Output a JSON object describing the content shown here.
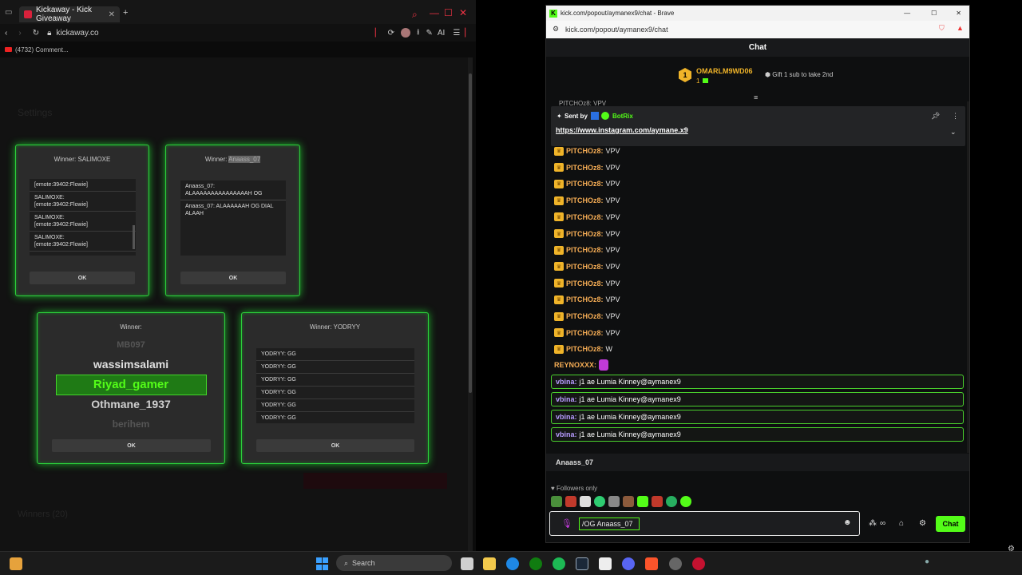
{
  "left_browser": {
    "tab_title": "Kickaway - Kick Giveaway",
    "new_tab": "+",
    "url": "kickaway.co",
    "bookmark": "(4732) Comment...",
    "ai_label": "AI",
    "ghost_title": "Settings",
    "ghost_bottom": "Winners (20)"
  },
  "cards": {
    "card1": {
      "title": "Winner: SALIMOXE",
      "messages": [
        {
          "user": "",
          "text": "[emote:39402:Flowie]"
        },
        {
          "user": "SALIMOXE:",
          "text": "[emote:39402:Flowie]"
        },
        {
          "user": "SALIMOXE:",
          "text": "[emote:39402:Flowie]"
        },
        {
          "user": "SALIMOXE:",
          "text": "[emote:39402:Flowie]"
        }
      ],
      "ok": "OK"
    },
    "card2": {
      "title_prefix": "Winner: ",
      "title_highlight": "Anaass_07",
      "messages": [
        {
          "user": "Anaass_07:",
          "text": "ALAAAAAAAAAAAAAAAH OG"
        },
        {
          "user": "Anaass_07:",
          "text": "ALAAAAAAH OG DIAL ALAAH"
        }
      ],
      "ok": "OK"
    },
    "card3": {
      "title": "Winner:",
      "names": [
        "MB097",
        "wassimsalami",
        "Riyad_gamer",
        "Othmane_1937",
        "berihem"
      ],
      "selected_index": 2,
      "ok": "OK"
    },
    "card4": {
      "title": "Winner: YODRYY",
      "messages": [
        "YODRYY: GG",
        "YODRYY: GG",
        "YODRYY: GG",
        "YODRYY: GG",
        "YODRYY: GG",
        "YODRYY: GG"
      ],
      "ok": "OK"
    }
  },
  "right_browser": {
    "window_title": "kick.com/popout/aymanex9/chat - Brave",
    "url": "kick.com/popout/aymanex9/chat",
    "chat_header": "Chat",
    "leader_rank": "1",
    "leader_name": "OMARLM9WD06",
    "leader_count": "1",
    "gift_text": "Gift 1 sub to take 2nd",
    "pinned_cut": "PITCHOz8: VPV",
    "pinned_sent_by": "Sent by",
    "pinned_bot": "BotRix",
    "pinned_link": "https://www.instagram.com/aymane.x9",
    "messages": [
      {
        "user": "PITCHOz8:",
        "text": "VPV"
      },
      {
        "user": "PITCHOz8:",
        "text": "VPV"
      },
      {
        "user": "PITCHOz8:",
        "text": "VPV"
      },
      {
        "user": "PITCHOz8:",
        "text": "VPV"
      },
      {
        "user": "PITCHOz8:",
        "text": "VPV"
      },
      {
        "user": "PITCHOz8:",
        "text": "VPV"
      },
      {
        "user": "PITCHOz8:",
        "text": "VPV"
      },
      {
        "user": "PITCHOz8:",
        "text": "VPV"
      },
      {
        "user": "PITCHOz8:",
        "text": "VPV"
      },
      {
        "user": "PITCHOz8:",
        "text": "VPV"
      },
      {
        "user": "PITCHOz8:",
        "text": "VPV"
      },
      {
        "user": "PITCHOz8:",
        "text": "VPV"
      },
      {
        "user": "PITCHOz8:",
        "text": "W"
      }
    ],
    "reynox_user": "REYNOXXX:",
    "highlighted": [
      {
        "user": "vbina:",
        "text": "j1 ae Lumia Kinney@aymanex9"
      },
      {
        "user": "vbina:",
        "text": "j1 ae Lumia Kinney@aymanex9"
      },
      {
        "user": "vbina:",
        "text": "j1 ae Lumia Kinney@aymanex9"
      },
      {
        "user": "vbina:",
        "text": "j1 ae Lumia Kinney@aymanex9"
      }
    ],
    "reply_to": "Anaass_07",
    "followers_only": "Followers only",
    "input_value": "/OG Anaass_07",
    "send_label": "Chat"
  },
  "taskbar": {
    "search_placeholder": "Search"
  },
  "colors": {
    "kick_green": "#53fc18",
    "card_glow": "#2cd13b",
    "username_orange": "#f6ad55",
    "username_purple": "#b79cff"
  }
}
